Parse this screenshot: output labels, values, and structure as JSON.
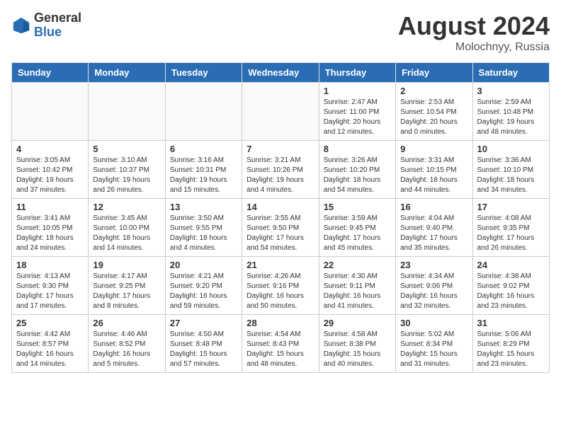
{
  "header": {
    "logo_general": "General",
    "logo_blue": "Blue",
    "month_year": "August 2024",
    "location": "Molochnyy, Russia"
  },
  "days_of_week": [
    "Sunday",
    "Monday",
    "Tuesday",
    "Wednesday",
    "Thursday",
    "Friday",
    "Saturday"
  ],
  "weeks": [
    [
      {
        "day": "",
        "info": ""
      },
      {
        "day": "",
        "info": ""
      },
      {
        "day": "",
        "info": ""
      },
      {
        "day": "",
        "info": ""
      },
      {
        "day": "1",
        "info": "Sunrise: 2:47 AM\nSunset: 11:00 PM\nDaylight: 20 hours\nand 12 minutes."
      },
      {
        "day": "2",
        "info": "Sunrise: 2:53 AM\nSunset: 10:54 PM\nDaylight: 20 hours\nand 0 minutes."
      },
      {
        "day": "3",
        "info": "Sunrise: 2:59 AM\nSunset: 10:48 PM\nDaylight: 19 hours\nand 48 minutes."
      }
    ],
    [
      {
        "day": "4",
        "info": "Sunrise: 3:05 AM\nSunset: 10:42 PM\nDaylight: 19 hours\nand 37 minutes."
      },
      {
        "day": "5",
        "info": "Sunrise: 3:10 AM\nSunset: 10:37 PM\nDaylight: 19 hours\nand 26 minutes."
      },
      {
        "day": "6",
        "info": "Sunrise: 3:16 AM\nSunset: 10:31 PM\nDaylight: 19 hours\nand 15 minutes."
      },
      {
        "day": "7",
        "info": "Sunrise: 3:21 AM\nSunset: 10:26 PM\nDaylight: 19 hours\nand 4 minutes."
      },
      {
        "day": "8",
        "info": "Sunrise: 3:26 AM\nSunset: 10:20 PM\nDaylight: 18 hours\nand 54 minutes."
      },
      {
        "day": "9",
        "info": "Sunrise: 3:31 AM\nSunset: 10:15 PM\nDaylight: 18 hours\nand 44 minutes."
      },
      {
        "day": "10",
        "info": "Sunrise: 3:36 AM\nSunset: 10:10 PM\nDaylight: 18 hours\nand 34 minutes."
      }
    ],
    [
      {
        "day": "11",
        "info": "Sunrise: 3:41 AM\nSunset: 10:05 PM\nDaylight: 18 hours\nand 24 minutes."
      },
      {
        "day": "12",
        "info": "Sunrise: 3:45 AM\nSunset: 10:00 PM\nDaylight: 18 hours\nand 14 minutes."
      },
      {
        "day": "13",
        "info": "Sunrise: 3:50 AM\nSunset: 9:55 PM\nDaylight: 18 hours\nand 4 minutes."
      },
      {
        "day": "14",
        "info": "Sunrise: 3:55 AM\nSunset: 9:50 PM\nDaylight: 17 hours\nand 54 minutes."
      },
      {
        "day": "15",
        "info": "Sunrise: 3:59 AM\nSunset: 9:45 PM\nDaylight: 17 hours\nand 45 minutes."
      },
      {
        "day": "16",
        "info": "Sunrise: 4:04 AM\nSunset: 9:40 PM\nDaylight: 17 hours\nand 35 minutes."
      },
      {
        "day": "17",
        "info": "Sunrise: 4:08 AM\nSunset: 9:35 PM\nDaylight: 17 hours\nand 26 minutes."
      }
    ],
    [
      {
        "day": "18",
        "info": "Sunrise: 4:13 AM\nSunset: 9:30 PM\nDaylight: 17 hours\nand 17 minutes."
      },
      {
        "day": "19",
        "info": "Sunrise: 4:17 AM\nSunset: 9:25 PM\nDaylight: 17 hours\nand 8 minutes."
      },
      {
        "day": "20",
        "info": "Sunrise: 4:21 AM\nSunset: 9:20 PM\nDaylight: 16 hours\nand 59 minutes."
      },
      {
        "day": "21",
        "info": "Sunrise: 4:26 AM\nSunset: 9:16 PM\nDaylight: 16 hours\nand 50 minutes."
      },
      {
        "day": "22",
        "info": "Sunrise: 4:30 AM\nSunset: 9:11 PM\nDaylight: 16 hours\nand 41 minutes."
      },
      {
        "day": "23",
        "info": "Sunrise: 4:34 AM\nSunset: 9:06 PM\nDaylight: 16 hours\nand 32 minutes."
      },
      {
        "day": "24",
        "info": "Sunrise: 4:38 AM\nSunset: 9:02 PM\nDaylight: 16 hours\nand 23 minutes."
      }
    ],
    [
      {
        "day": "25",
        "info": "Sunrise: 4:42 AM\nSunset: 8:57 PM\nDaylight: 16 hours\nand 14 minutes."
      },
      {
        "day": "26",
        "info": "Sunrise: 4:46 AM\nSunset: 8:52 PM\nDaylight: 16 hours\nand 5 minutes."
      },
      {
        "day": "27",
        "info": "Sunrise: 4:50 AM\nSunset: 8:48 PM\nDaylight: 15 hours\nand 57 minutes."
      },
      {
        "day": "28",
        "info": "Sunrise: 4:54 AM\nSunset: 8:43 PM\nDaylight: 15 hours\nand 48 minutes."
      },
      {
        "day": "29",
        "info": "Sunrise: 4:58 AM\nSunset: 8:38 PM\nDaylight: 15 hours\nand 40 minutes."
      },
      {
        "day": "30",
        "info": "Sunrise: 5:02 AM\nSunset: 8:34 PM\nDaylight: 15 hours\nand 31 minutes."
      },
      {
        "day": "31",
        "info": "Sunrise: 5:06 AM\nSunset: 8:29 PM\nDaylight: 15 hours\nand 23 minutes."
      }
    ]
  ]
}
